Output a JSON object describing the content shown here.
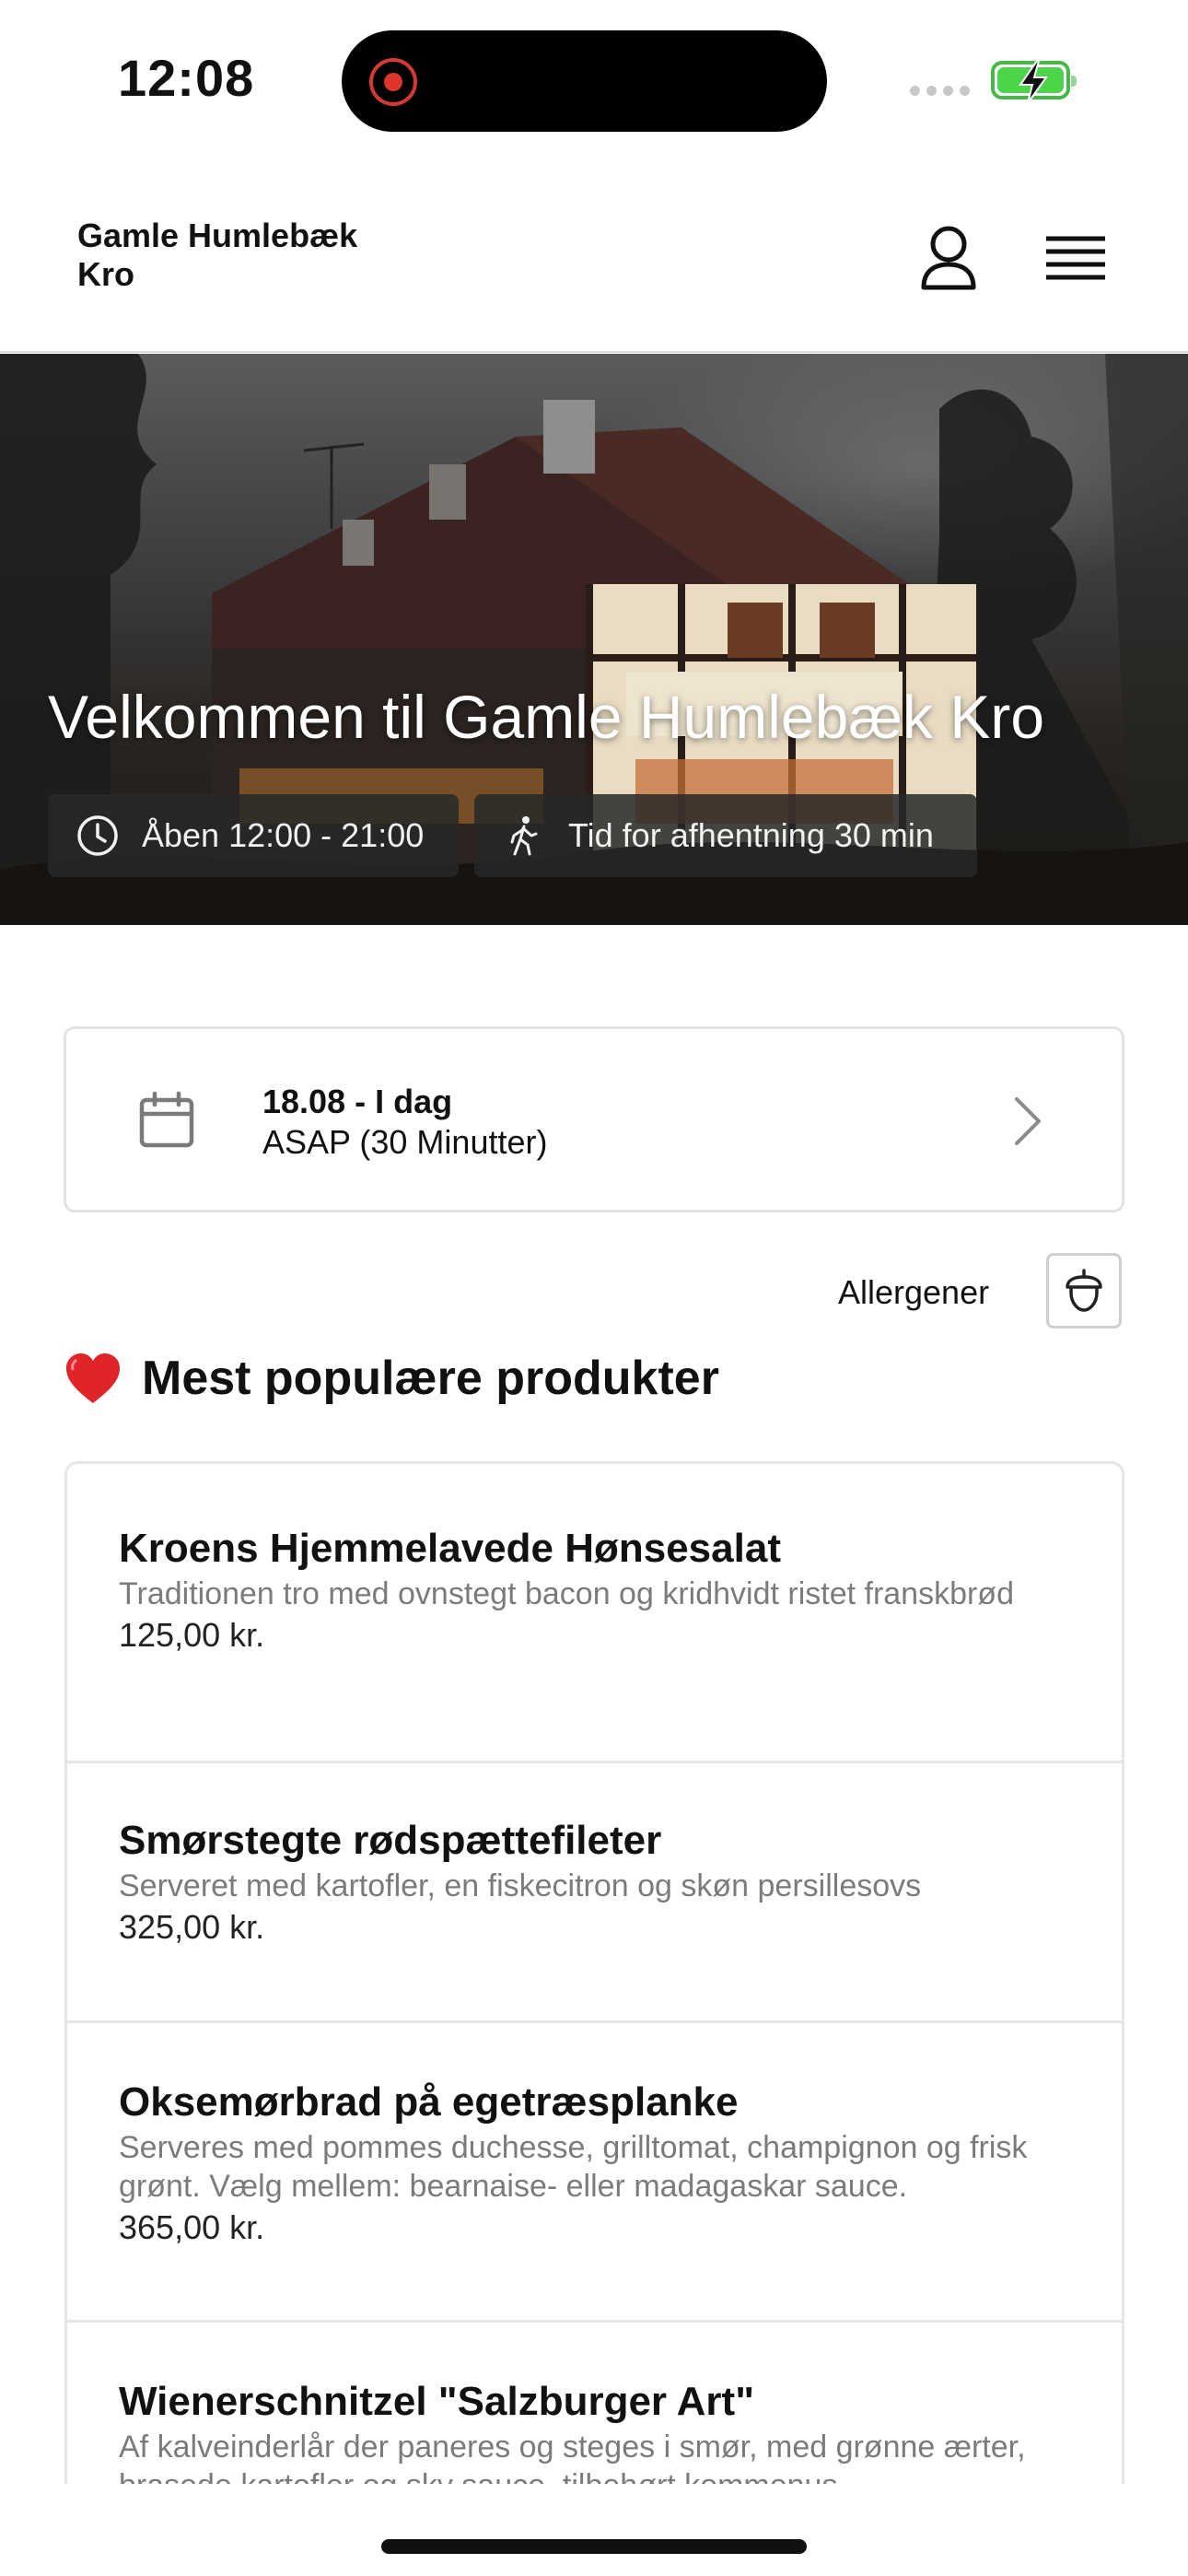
{
  "status_bar": {
    "time": "12:08"
  },
  "header": {
    "restaurant_name": "Gamle Humlebæk Kro",
    "icons": [
      "user-icon",
      "hamburger-menu-icon"
    ]
  },
  "hero": {
    "title": "Velkommen til Gamle Humlebæk Kro",
    "opening_hours": "Åben 12:00 - 21:00",
    "pickup_time": "Tid for afhentning 30 min",
    "icons": [
      "clock-icon",
      "walking-person-icon"
    ]
  },
  "order_time": {
    "date": "18.08 - I dag",
    "when": "ASAP (30 Minutter)"
  },
  "allergens": {
    "label": "Allergener"
  },
  "popular": {
    "title": "Mest populære produkter",
    "emoji": "❤️",
    "products": [
      {
        "name": "Kroens Hjemmelavede Hønsesalat",
        "description": "Traditionen tro med ovnstegt bacon og kridhvidt ristet franskbrød",
        "price": "125,00 kr."
      },
      {
        "name": "Smørstegte rødspættefileter",
        "description": "Serveret med kartofler, en fiskecitron og skøn persillesovs",
        "price": "325,00 kr."
      },
      {
        "name": "Oksemørbrad på egetræsplanke",
        "description": "Serveres med pommes duchesse, grilltomat, champignon og frisk grønt. Vælg mellem: bearnaise- eller madagaskar sauce.",
        "price": "365,00 kr."
      },
      {
        "name": "Wienerschnitzel \"Salzburger Art\"",
        "description": "Af kalveinderlår der paneres og steges i smør, med grønne ærter, brasede kartofler og sky sauce, tilbehørt kommenus",
        "price": ""
      }
    ]
  },
  "colors": {
    "accent": "#111111",
    "muted_text": "#7b7b7b",
    "border": "#e6e6e6",
    "recording": "#e0352b",
    "battery": "#4cd44a"
  }
}
